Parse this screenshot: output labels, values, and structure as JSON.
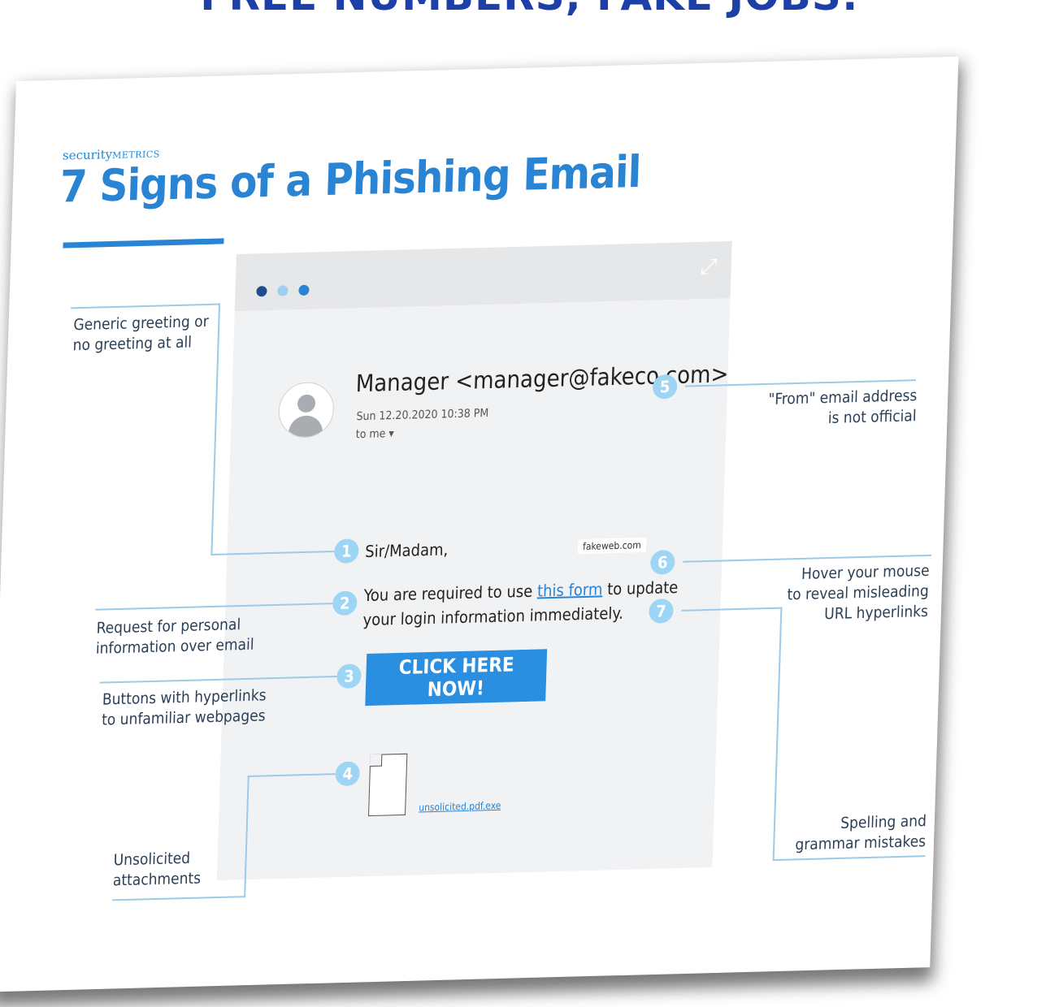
{
  "banner": {
    "text": "FREE NUMBERS, FAKE JOBS:"
  },
  "infographic": {
    "brand_prefix": "security",
    "brand_suffix": "METRICS",
    "title": "7 Signs of a Phishing Email"
  },
  "email": {
    "sender": "Manager <manager@fakeco.com>",
    "date": "Sun 12.20.2020 10:38 PM",
    "to": "to me ▾",
    "greeting": "Sir/Madam,",
    "url_tooltip": "fakeweb.com",
    "body_pre": "You are required to use ",
    "body_link": "this form",
    "body_post": " to update",
    "body_line2": "your login information immediately.",
    "button_label": "CLICK HERE NOW!",
    "attachment": "unsolicited.pdf.exe"
  },
  "markers": [
    "1",
    "2",
    "3",
    "4",
    "5",
    "6",
    "7"
  ],
  "labels": {
    "generic_greeting": [
      "Generic greeting or",
      "no greeting at all"
    ],
    "personal_info": [
      "Request for personal",
      "information over email"
    ],
    "buttons": [
      "Buttons with hyperlinks",
      "to unfamiliar webpages"
    ],
    "attachments": [
      "Unsolicited",
      "attachments"
    ],
    "from_address": [
      "\"From\" email address",
      "is not official"
    ],
    "hover": [
      "Hover your mouse",
      "to reveal misleading",
      "URL hyperlinks"
    ],
    "spelling": [
      "Spelling and",
      "grammar mistakes"
    ]
  },
  "colors": {
    "banner": "#1c3fa8",
    "accent": "#2a84d4",
    "marker": "#9fd5f4",
    "leader": "#9ccbe8"
  }
}
